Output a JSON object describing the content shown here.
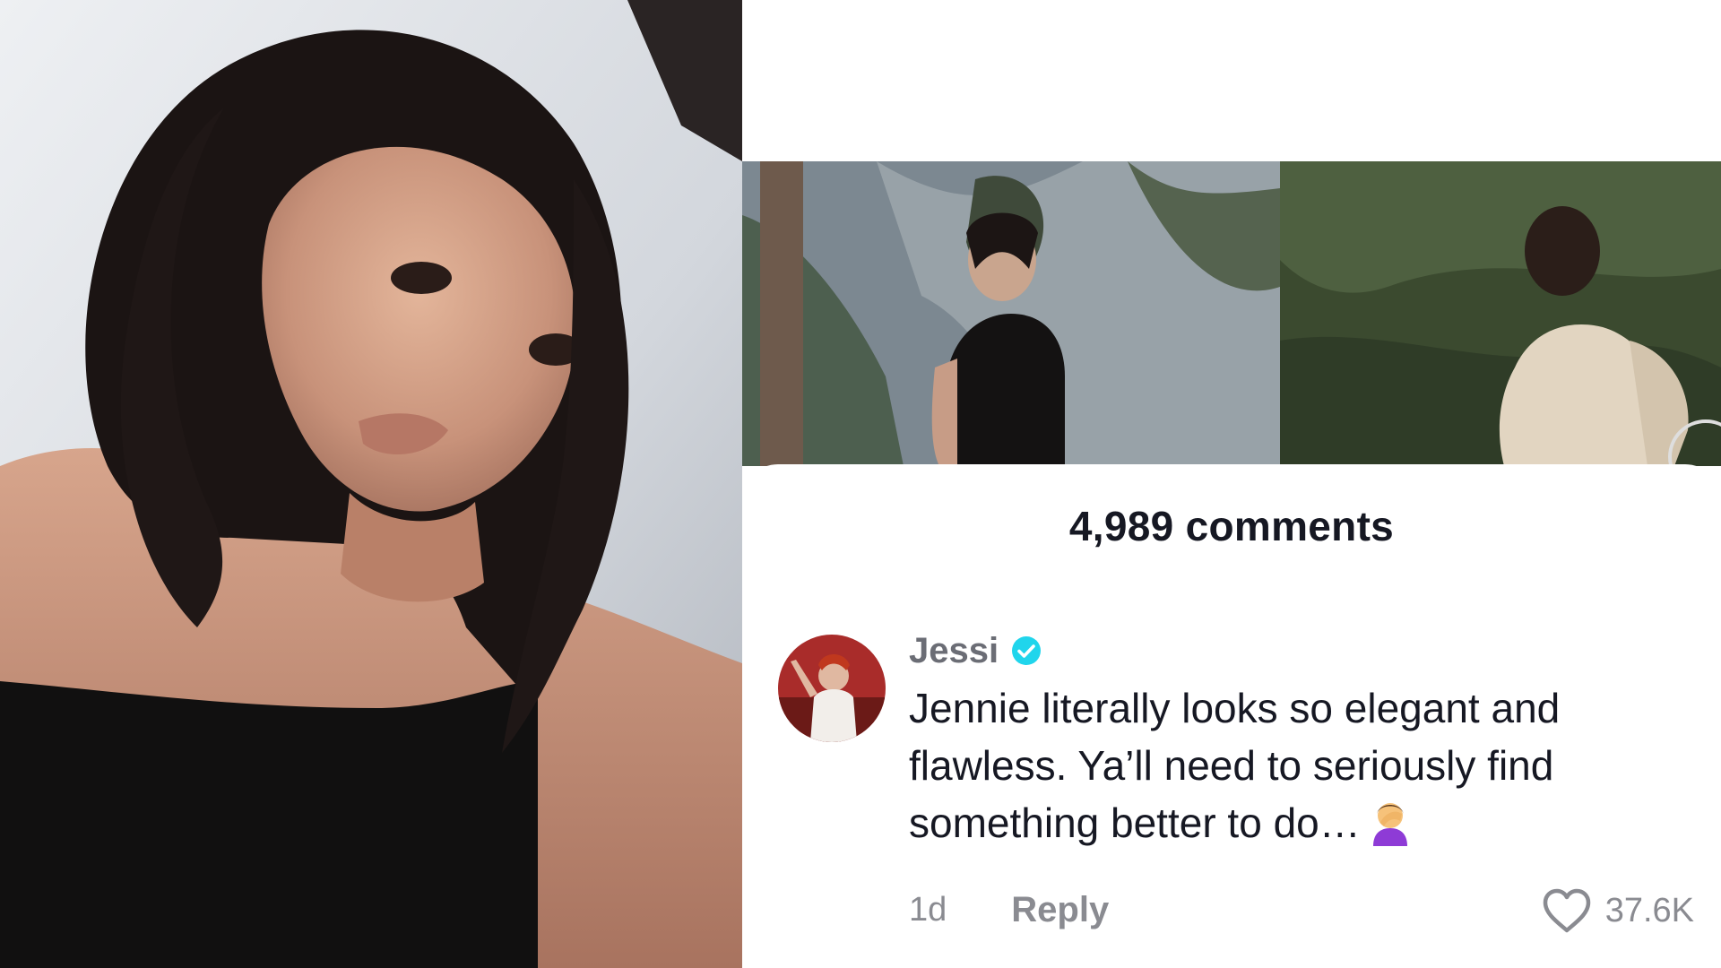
{
  "selfie": {
    "icon": "selfie-photo"
  },
  "video": {
    "icon": "video-thumbnail"
  },
  "comments": {
    "count_label": "4,989 comments",
    "items": [
      {
        "username": "Jessi",
        "verified": true,
        "text": "Jennie literally looks so elegant and flawless. Ya’ll need to seriously find something better to do…",
        "emoji_icon": "person-facepalming-icon",
        "time": "1d",
        "reply_label": "Reply",
        "likes": "37.6K"
      }
    ]
  },
  "colors": {
    "text_primary": "#161823",
    "text_secondary": "#8a8b91",
    "verified": "#20d5ec"
  }
}
